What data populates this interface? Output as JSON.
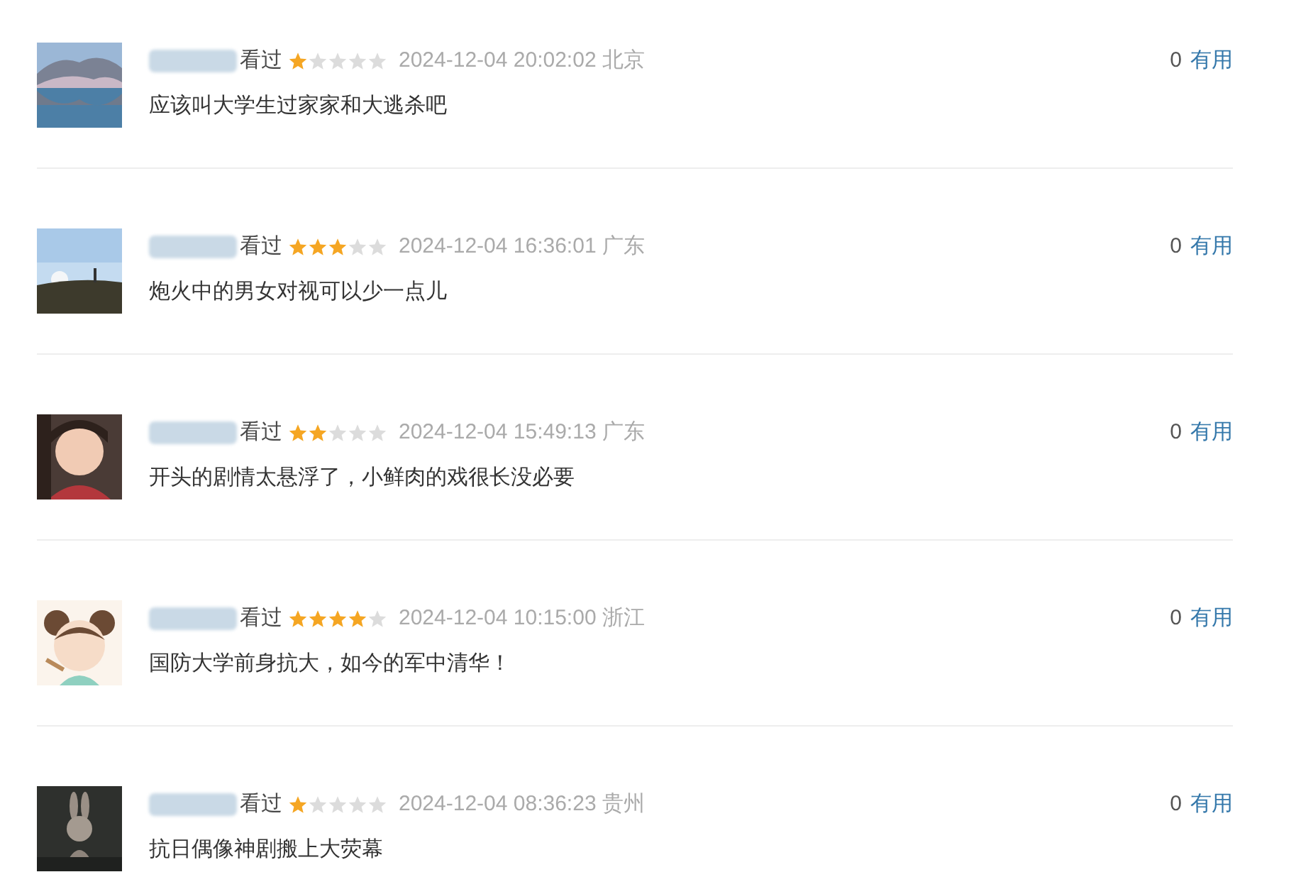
{
  "reviews": [
    {
      "status": "看过",
      "stars": 1,
      "time": "2024-12-04 20:02:02",
      "region": "北京",
      "text": "应该叫大学生过家家和大逃杀吧",
      "votes": "0",
      "useful": "有用"
    },
    {
      "status": "看过",
      "stars": 3,
      "time": "2024-12-04 16:36:01",
      "region": "广东",
      "text": "炮火中的男女对视可以少一点儿",
      "votes": "0",
      "useful": "有用"
    },
    {
      "status": "看过",
      "stars": 2,
      "time": "2024-12-04 15:49:13",
      "region": "广东",
      "text": "开头的剧情太悬浮了，小鲜肉的戏很长没必要",
      "votes": "0",
      "useful": "有用"
    },
    {
      "status": "看过",
      "stars": 4,
      "time": "2024-12-04 10:15:00",
      "region": "浙江",
      "text": "国防大学前身抗大，如今的军中清华！",
      "votes": "0",
      "useful": "有用"
    },
    {
      "status": "看过",
      "stars": 1,
      "time": "2024-12-04 08:36:23",
      "region": "贵州",
      "text": "抗日偶像神剧搬上大荧幕",
      "votes": "0",
      "useful": "有用"
    }
  ]
}
